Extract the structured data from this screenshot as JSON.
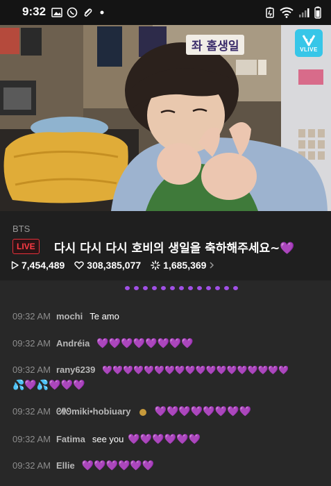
{
  "status_bar": {
    "time": "9:32"
  },
  "video": {
    "banner": "좌 홈생일",
    "vlive_label": "VLIVE"
  },
  "channel": "BTS",
  "live_label": "LIVE",
  "title": "다시 다시 다시 호비의 생일을 축하해주세요~",
  "title_emoji": "💜",
  "stats": {
    "plays": "7,454,489",
    "likes": "308,385,077",
    "comments": "1,685,369"
  },
  "chat": [
    {
      "time": "09:32 AM",
      "user": "mochi",
      "text": "Te amo",
      "emoji": ""
    },
    {
      "time": "09:32 AM",
      "user": "Andréia",
      "text": "",
      "emoji": "💜💜💜💜💜💜💜💜"
    },
    {
      "time": "09:32 AM",
      "user": "rany6239",
      "text": "",
      "emoji": "💜💜💜💜💜💜💜💜💜💜💜💜💜💜💜💜💜💜",
      "emoji_line2": "💦💜💦💜💜💜"
    },
    {
      "time": "09:32 AM",
      "user": "ᘛᘚmiki•hobiuary",
      "text": "",
      "emoji": "💜💜💜💜💜💜💜💜"
    },
    {
      "time": "09:32 AM",
      "user": "Fatima",
      "text": "see you",
      "emoji": "💜💜💜💜💜💜"
    },
    {
      "time": "09:32 AM",
      "user": "Ellie",
      "text": "",
      "emoji": "💜💜💜💜💜💜"
    }
  ],
  "colors": {
    "accent_purple": "#a64ff0",
    "live_red": "#ff3b44",
    "vlive_blue": "#37c6e8"
  }
}
